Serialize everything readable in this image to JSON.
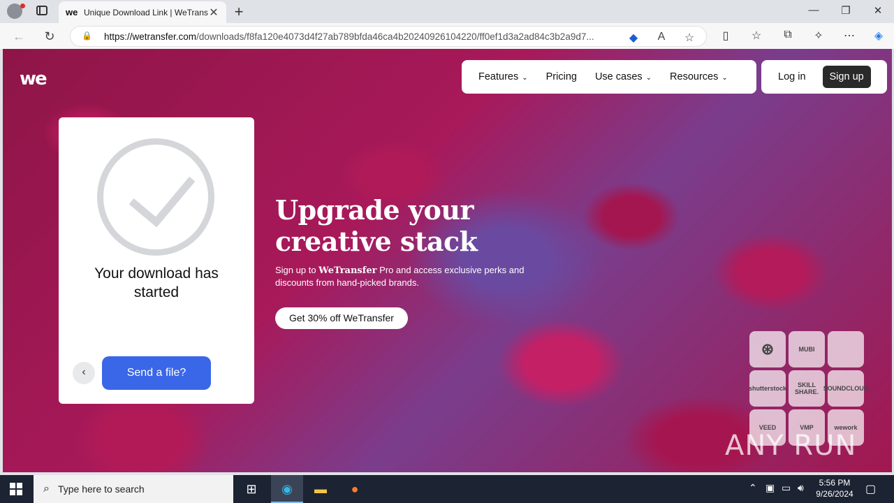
{
  "browser": {
    "tab_title": "Unique Download Link | WeTrans",
    "tab_favicon": "we",
    "url_host": "https://wetransfer.com",
    "url_path": "/downloads/f8fa120e4073d4f27ab789bfda46ca4b20240926104220/ff0ef1d3a2ad84c3b2a9d7..."
  },
  "site": {
    "logo": "we",
    "nav": [
      "Features",
      "Pricing",
      "Use cases",
      "Resources"
    ],
    "login": "Log in",
    "signup": "Sign up"
  },
  "download_card": {
    "title": "Your download has started",
    "send_button": "Send a file?"
  },
  "hero": {
    "title_line1": "Upgrade your",
    "title_line2": "creative stack",
    "subtitle_pre": "Sign up to ",
    "subtitle_brand": "WeTransfer",
    "subtitle_post": " Pro and access exclusive perks and discounts from hand-picked brands.",
    "cta": "Get 30% off WeTransfer"
  },
  "brands": [
    "",
    "MUBI",
    "",
    "shutterstock",
    "SKILL SHARE.",
    "SOUNDCLOUD",
    "VEED",
    "VMP",
    "wework"
  ],
  "watermark": "ANY RUN",
  "taskbar": {
    "search_placeholder": "Type here to search",
    "time": "5:56 PM",
    "date": "9/26/2024"
  },
  "colors": {
    "primary_button": "#3a66e8",
    "signup_bg": "#2a2a2a"
  }
}
